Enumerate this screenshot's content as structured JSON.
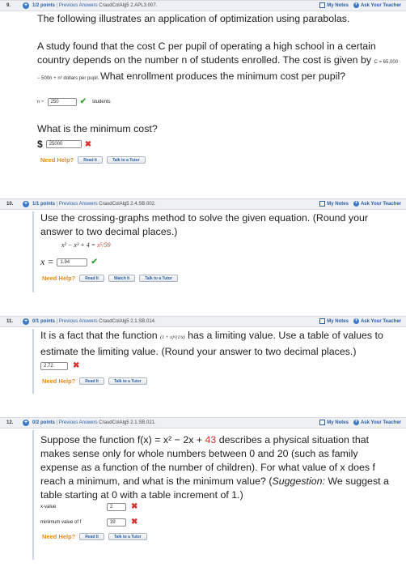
{
  "q9": {
    "num": "9.",
    "points": "1/2 points",
    "sep": "|",
    "prev": "Previous Answers",
    "source": "CraudColAlg5 2.APL3.007.",
    "notes": "My Notes",
    "ask": "Ask Your Teacher",
    "line1": "The following illustrates an application of optimization using parabolas.",
    "para1": "A study found that the cost C per pupil of operating a high school in a certain country depends on the number n of students enrolled. The cost is given by",
    "formula": "C = 65,000 − 500n + n² dollars per pupil.",
    "para1b": "What enrollment produces the minimum cost per pupil?",
    "n_label": "n =",
    "n_value": "250",
    "students": "students",
    "min_cost_q": "What is the minimum cost?",
    "dollar": "$",
    "cost_value": "25000",
    "help": "Need Help?",
    "read": "Read It",
    "talk": "Talk to a Tutor"
  },
  "q10": {
    "num": "10.",
    "points": "1/1 points",
    "sep": "|",
    "prev": "Previous Answers",
    "source": "CraudColAlg5 2.4.SB.002.",
    "notes": "My Notes",
    "ask": "Ask Your Teacher",
    "text": "Use the crossing-graphs method to solve the given equation. (Round your answer to two decimal places.)",
    "eq_left": "x² − x³ + 4 = ",
    "eq_right": "x⁵/59",
    "x_label": "x =",
    "x_value": "1.94",
    "help": "Need Help?",
    "read": "Read It",
    "watch": "Watch It",
    "talk": "Talk to a Tutor"
  },
  "q11": {
    "num": "11.",
    "points": "0/1 points",
    "sep": "|",
    "prev": "Previous Answers",
    "source": "CraudColAlg5 2.1.SB.014.",
    "notes": "My Notes",
    "ask": "Ask Your Teacher",
    "text1": "It is a fact that the function",
    "func": "(1 + x)^(1/x)",
    "text2": "has a limiting value. Use a table of values to estimate the limiting value. (Round your answer to two decimal places.)",
    "value": "2.72",
    "help": "Need Help?",
    "read": "Read It",
    "talk": "Talk to a Tutor"
  },
  "q12": {
    "num": "12.",
    "points": "0/2 points",
    "sep": "|",
    "prev": "Previous Answers",
    "source": "CraudColAlg5 2.1.SB.021.",
    "notes": "My Notes",
    "ask": "Ask Your Teacher",
    "text_a": "Suppose the function f(x) = x² − 2x + ",
    "text_num": "43",
    "text_b": " describes a physical situation that makes sense only for whole numbers between 0 and 20 (such as family expense as a function of the number of children). For what value of x does f reach a minimum, and what is the minimum value? (",
    "suggestion": "Suggestion:",
    "text_c": " We suggest a table starting at 0 with a table increment of 1.)",
    "xval_label": "x-value",
    "xval": "2",
    "minval_label": "minimum value of f",
    "minval": "39",
    "help": "Need Help?",
    "read": "Read It",
    "talk": "Talk to a Tutor"
  },
  "colors": {
    "link": "#2a5fa8",
    "help": "#e38a1f",
    "correct": "#3aa33a",
    "wrong": "#d33333"
  },
  "icons": [
    "check-icon",
    "cross-icon",
    "plus-circle-icon",
    "notes-checkbox-icon"
  ]
}
